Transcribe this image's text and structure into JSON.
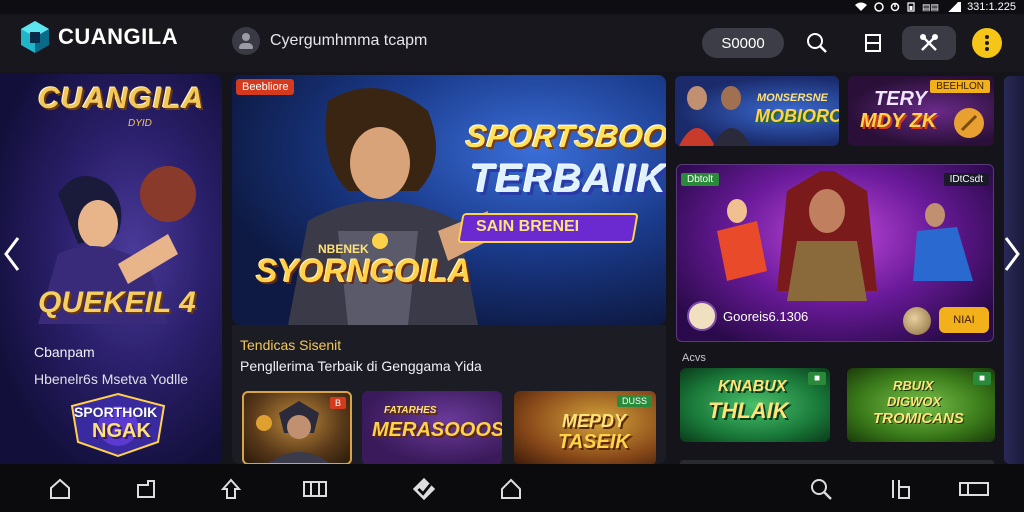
{
  "status_bar": {
    "time": "331:1.225"
  },
  "header": {
    "logo_text": "CUANGILA",
    "profile_name": "Cyergumhmma tcapm",
    "balance": "S0000"
  },
  "left_panel": {
    "brand": "CUANGILA",
    "brand_sub": "DYID",
    "headline": "QUEKEIL 4",
    "caption_1": "Cbanpam",
    "caption_2": "Hbenelr6s Msetva Yodlle",
    "badge_line_1": "SPORTHOIK",
    "badge_line_2": "NGAK"
  },
  "hero": {
    "tag": "Beebliore",
    "line_1": "SPORTSBOOK",
    "line_2": "TERBAIIK",
    "banner": "SAIN BRENEI",
    "logo_small": "NBENEK",
    "logo_main": "SYORNGOILA"
  },
  "trending": {
    "title": "Tendicas Sisenit",
    "description": "Pengllerima Terbaik di Genggama Yida",
    "games": [
      {
        "tag": "B",
        "title": ""
      },
      {
        "tag": "",
        "title": "MERASOOOS",
        "title_small": "FATARHES"
      },
      {
        "tag": "DUSS",
        "title": "TASEIK",
        "title_small": "MEPDY"
      }
    ]
  },
  "right_cards": {
    "top_left": {
      "title_small": "MONSERSNE",
      "title": "MOBIORO"
    },
    "top_right": {
      "tag": "BEEHLON",
      "title_small": "TERY",
      "title": "MDY ZK"
    },
    "featured": {
      "tag_left": "Dbtolt",
      "tag_right": "IDtCsdt",
      "provider": "Gooreis6.1306",
      "play_label": "NIAI"
    },
    "section_label": "Acvs",
    "bottom_left": {
      "title_small": "KNABUX",
      "title": "THLAIK"
    },
    "bottom_right": {
      "title_small": "RBUIX",
      "title_mid": "DIGWOX",
      "title": "TROMICANS"
    }
  },
  "icons": {
    "header": [
      "logo-cube-icon",
      "avatar-icon",
      "search-icon",
      "list-icon",
      "tools-icon",
      "more-icon"
    ],
    "bottom_nav": [
      "home-icon",
      "sports-icon",
      "promo-icon",
      "casino-icon",
      "bet-slip-icon",
      "history-icon",
      "search-icon",
      "menu-icon",
      "wallet-icon"
    ]
  },
  "colors": {
    "accent_gold": "#f5c518",
    "background": "#121218",
    "topbar": "#17171d"
  }
}
